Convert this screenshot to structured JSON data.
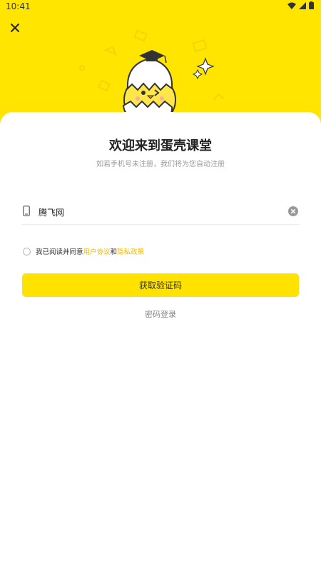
{
  "status_bar": {
    "time": "10:41"
  },
  "header": {
    "close_icon": "close-icon",
    "background": "#FFE500"
  },
  "welcome": {
    "title": "欢迎来到蛋壳课堂",
    "subtitle": "如若手机号未注册，我们将为您自动注册"
  },
  "phone": {
    "icon": "phone-icon",
    "value": "腾飞网",
    "clear_icon": "clear-icon"
  },
  "agreement": {
    "prefix": "我已阅读并同意",
    "user_agreement": "用户协议",
    "and": "和",
    "privacy_policy": "隐私政策",
    "link_color": "#F5B700"
  },
  "actions": {
    "get_code": "获取验证码",
    "password_login": "密码登录"
  },
  "colors": {
    "accent": "#FFE200"
  }
}
